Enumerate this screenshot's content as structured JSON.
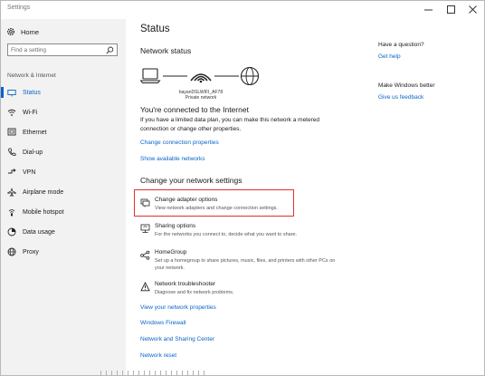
{
  "window": {
    "title": "Settings"
  },
  "sidebar": {
    "home_label": "Home",
    "search_placeholder": "Find a setting",
    "section_label": "Network & Internet",
    "items": [
      {
        "label": "Status",
        "icon": "status-icon"
      },
      {
        "label": "Wi-Fi",
        "icon": "wifi-icon"
      },
      {
        "label": "Ethernet",
        "icon": "ethernet-icon"
      },
      {
        "label": "Dial-up",
        "icon": "phone-icon"
      },
      {
        "label": "VPN",
        "icon": "vpn-icon"
      },
      {
        "label": "Airplane mode",
        "icon": "airplane-icon"
      },
      {
        "label": "Mobile hotspot",
        "icon": "hotspot-icon"
      },
      {
        "label": "Data usage",
        "icon": "data-usage-icon"
      },
      {
        "label": "Proxy",
        "icon": "globe-icon"
      }
    ],
    "active_index": 0
  },
  "main": {
    "title": "Status",
    "network_status_heading": "Network status",
    "network_name": "bayanDSLWIFI_AF78",
    "network_type": "Private network",
    "connected_heading": "You're connected to the Internet",
    "connected_text": "If you have a limited data plan, you can make this network a metered connection or change other properties.",
    "links": {
      "change_properties": "Change connection properties",
      "show_networks": "Show available networks"
    },
    "change_heading": "Change your network settings",
    "options": [
      {
        "title": "Change adapter options",
        "desc": "View network adapters and change connection settings.",
        "icon": "adapter-icon"
      },
      {
        "title": "Sharing options",
        "desc": "For the networks you connect to, decide what you want to share.",
        "icon": "sharing-icon"
      },
      {
        "title": "HomeGroup",
        "desc": "Set up a homegroup to share pictures, music, files, and printers with other PCs on your network.",
        "icon": "homegroup-icon"
      },
      {
        "title": "Network troubleshooter",
        "desc": "Diagnose and fix network problems.",
        "icon": "warning-icon"
      }
    ],
    "bottom_links": {
      "view_properties": "View your network properties",
      "firewall": "Windows Firewall",
      "sharing_center": "Network and Sharing Center",
      "reset": "Network reset"
    }
  },
  "right_panel": {
    "question_heading": "Have a question?",
    "get_help": "Get help",
    "better_heading": "Make Windows better",
    "feedback": "Give us feedback"
  },
  "colors": {
    "accent": "#0a64c8",
    "highlight_box": "#e03030",
    "sidebar_bg": "#f2f2f2"
  }
}
